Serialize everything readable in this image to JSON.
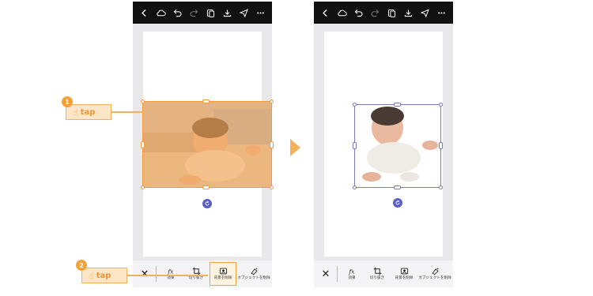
{
  "callouts": [
    {
      "number": "1",
      "label": "tap"
    },
    {
      "number": "2",
      "label": "tap"
    }
  ],
  "phone_before": {
    "topbar_icons": [
      "chevron-left-icon",
      "cloud-icon",
      "undo-icon",
      "redo-icon",
      "layers-icon",
      "download-icon",
      "share-icon",
      "more-icon"
    ],
    "toolbar": {
      "close": "✕",
      "tools": [
        {
          "icon": "fx-icon",
          "label": "効果"
        },
        {
          "icon": "crop-icon",
          "label": "切り抜き"
        },
        {
          "icon": "remove-background-icon",
          "label": "背景を削除"
        },
        {
          "icon": "remove-object-icon",
          "label": "オブジェクトを削除"
        }
      ]
    }
  },
  "phone_after": {
    "topbar_icons": [
      "chevron-left-icon",
      "cloud-icon",
      "undo-icon",
      "redo-icon",
      "layers-icon",
      "download-icon",
      "share-icon",
      "more-icon"
    ],
    "toolbar": {
      "close": "✕",
      "tools": [
        {
          "icon": "fx-icon",
          "label": "効果"
        },
        {
          "icon": "crop-icon",
          "label": "切り抜き"
        },
        {
          "icon": "remove-background-icon",
          "label": "背景を削除"
        },
        {
          "icon": "remove-object-icon",
          "label": "オブジェクトを削除"
        }
      ]
    }
  },
  "colors": {
    "accent": "#f2a23a",
    "selection": "#7a7ab5",
    "rotate": "#5a5fc2",
    "topbar": "#111111"
  }
}
